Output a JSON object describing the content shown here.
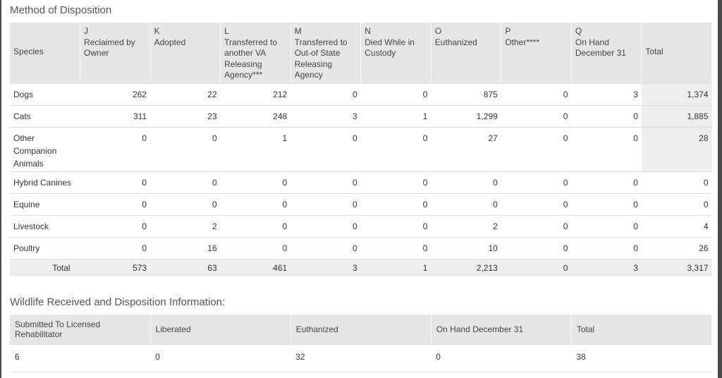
{
  "disposition": {
    "title": "Method of Disposition",
    "headers": [
      {
        "letter": "",
        "label": "Species"
      },
      {
        "letter": "J",
        "label": "Reclaimed by Owner"
      },
      {
        "letter": "K",
        "label": "Adopted"
      },
      {
        "letter": "L",
        "label": "Transferred to another VA Releasing Agency***"
      },
      {
        "letter": "M",
        "label": "Transferred to Out-of State Releasing Agency"
      },
      {
        "letter": "N",
        "label": "Died While in Custody"
      },
      {
        "letter": "O",
        "label": "Euthanized"
      },
      {
        "letter": "P",
        "label": "Other****"
      },
      {
        "letter": "Q",
        "label": "On Hand December 31"
      },
      {
        "letter": "",
        "label": "Total"
      }
    ],
    "rows": [
      {
        "species": "Dogs",
        "values": [
          "262",
          "22",
          "212",
          "0",
          "0",
          "875",
          "0",
          "3"
        ],
        "total": "1,374"
      },
      {
        "species": "Cats",
        "values": [
          "311",
          "23",
          "248",
          "3",
          "1",
          "1,299",
          "0",
          "0"
        ],
        "total": "1,885"
      },
      {
        "species": "Other Companion Animals",
        "values": [
          "0",
          "0",
          "1",
          "0",
          "0",
          "27",
          "0",
          "0"
        ],
        "total": "28"
      },
      {
        "species": "Hybrid Canines",
        "values": [
          "0",
          "0",
          "0",
          "0",
          "0",
          "0",
          "0",
          "0"
        ],
        "total": "0"
      },
      {
        "species": "Equine",
        "values": [
          "0",
          "0",
          "0",
          "0",
          "0",
          "0",
          "0",
          "0"
        ],
        "total": "0"
      },
      {
        "species": "Livestock",
        "values": [
          "0",
          "2",
          "0",
          "0",
          "0",
          "2",
          "0",
          "0"
        ],
        "total": "4"
      },
      {
        "species": "Poultry",
        "values": [
          "0",
          "16",
          "0",
          "0",
          "0",
          "10",
          "0",
          "0"
        ],
        "total": "26"
      }
    ],
    "totals": {
      "label": "Total",
      "values": [
        "573",
        "63",
        "461",
        "3",
        "1",
        "2,213",
        "0",
        "3"
      ],
      "total": "3,317"
    }
  },
  "wildlife": {
    "title": "Wildlife Received and Disposition Information:",
    "headers": [
      "Submitted To Licensed Rehabilitator",
      "Liberated",
      "Euthanized",
      "On Hand December 31",
      "Total"
    ],
    "values": [
      "6",
      "0",
      "32",
      "0",
      "38"
    ]
  }
}
